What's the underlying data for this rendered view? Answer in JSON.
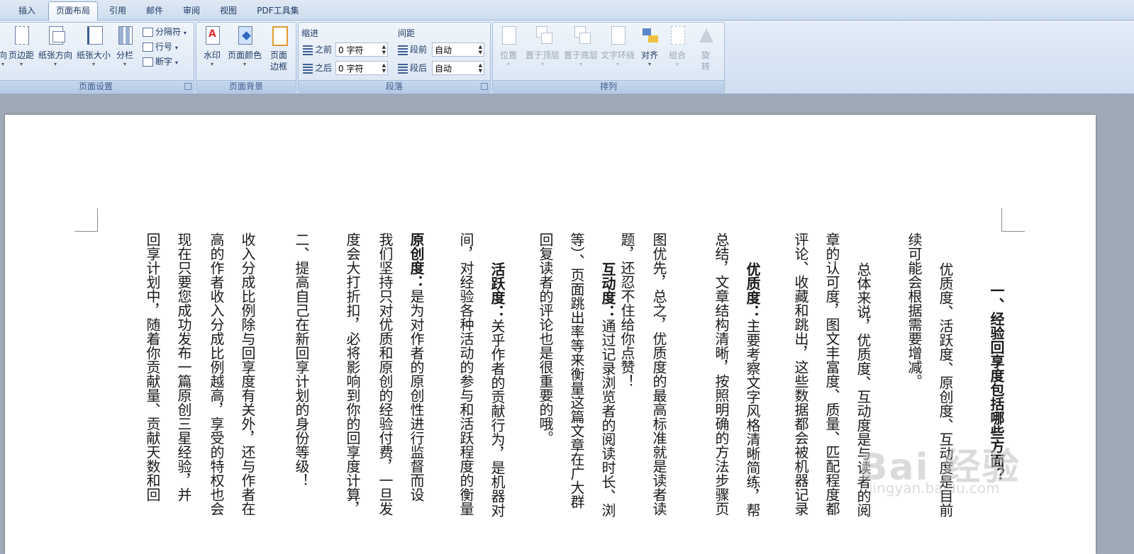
{
  "tabs": [
    {
      "label": "插入",
      "active": false
    },
    {
      "label": "页面布局",
      "active": true
    },
    {
      "label": "引用",
      "active": false
    },
    {
      "label": "邮件",
      "active": false
    },
    {
      "label": "审阅",
      "active": false
    },
    {
      "label": "视图",
      "active": false
    },
    {
      "label": "PDF工具集",
      "active": false
    }
  ],
  "page_setup": {
    "caption": "页面设置",
    "orientation_partial": "向",
    "margins": "页边距",
    "paper_orientation": "纸张方向",
    "paper_size": "纸张大小",
    "columns": "分栏",
    "breaks": "分隔符",
    "line_numbers": "行号",
    "hyphenation": "断字"
  },
  "page_background": {
    "caption": "页面背景",
    "watermark": "水印",
    "page_color": "页面颜色",
    "page_border_line1": "页面",
    "page_border_line2": "边框"
  },
  "paragraph": {
    "caption": "段落",
    "indent_title": "缩进",
    "spacing_title": "间距",
    "indent_before_label": "之前",
    "indent_before_value": "0 字符",
    "indent_after_label": "之后",
    "indent_after_value": "0 字符",
    "space_before_label": "段前",
    "space_before_value": "自动",
    "space_after_label": "段后",
    "space_after_value": "自动"
  },
  "arrange": {
    "caption": "排列",
    "position": "位置",
    "bring_front": "置于顶层",
    "send_back": "置于底层",
    "text_wrap": "文字环绕",
    "align": "对齐",
    "group": "组合",
    "rotate_line1": "旋",
    "rotate_line2": "转"
  },
  "document": {
    "columns": [
      {
        "bold": "一、经验回享度包括哪些方面？",
        "text": ""
      },
      {
        "bold": "",
        "text": "优质度、活跃度、原创度、互动度是目前"
      },
      {
        "bold": "",
        "text": "续可能会根据需要增减。"
      },
      {
        "bold": "",
        "text": "总体来说，优质度、互动度是与读者的阅"
      },
      {
        "bold": "",
        "text": "章的认可度，图文丰富度、质量、匹配程度都"
      },
      {
        "bold": "",
        "text": "评论、收藏和跳出，这些数据都会被机器记录"
      },
      {
        "bold": "优质度：",
        "text": "主要考察文字风格清晰简练，帮"
      },
      {
        "bold": "",
        "text": "总结，文章结构清晰，按照明确的方法步骤页"
      },
      {
        "bold": "",
        "text": "图优先，总之，优质度的最高标准就是读者读"
      },
      {
        "bold": "",
        "text": "题，还忍不住给你点赞！"
      },
      {
        "bold": "互动度：",
        "text": "通过记录浏览者的阅读时长、浏"
      },
      {
        "bold": "",
        "text": "等）、页面跳出率等来衡量这篇文章在广大群"
      },
      {
        "bold": "",
        "text": "回复读者的评论也是很重要的哦。"
      },
      {
        "bold": "活跃度：",
        "text": "关乎作者的贡献行为，是机器对"
      },
      {
        "bold": "",
        "text": "间，对经验各种活动的参与和活跃程度的衡量"
      },
      {
        "bold": "原创度：",
        "text": "是为对作者的原创性进行监督而设"
      },
      {
        "bold": "",
        "text": "我们坚持只对优质和原创的经验付费，一旦发"
      },
      {
        "bold": "",
        "text": "度会大打折扣，必将影响到你的回享度计算，"
      },
      {
        "bold": "",
        "text": "二、提高自己在新回享计划的身份等级！"
      },
      {
        "bold": "",
        "text": "收入分成比例除与回享度有关外，还与作者在"
      },
      {
        "bold": "",
        "text": "高的作者收入分成比例越高，享受的特权也会"
      },
      {
        "bold": "",
        "text": "现在只要您成功发布一篇原创三星经验，并"
      },
      {
        "bold": "",
        "text": "回享计划中，随着你贡献量、贡献天数和回"
      }
    ],
    "watermark_logo": "Bai 经验",
    "watermark_url": "jingyan.baidu.com"
  }
}
